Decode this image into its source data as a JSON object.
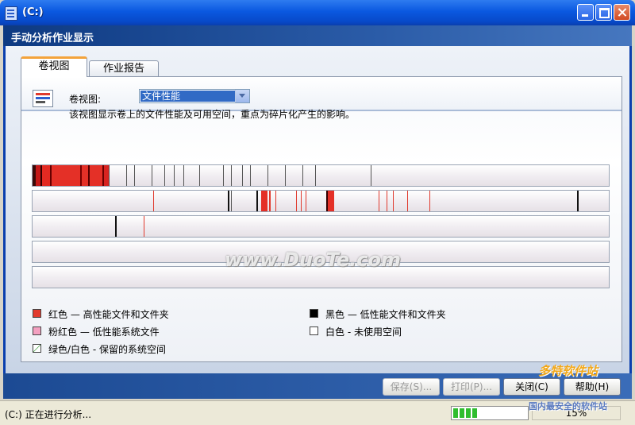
{
  "window": {
    "title": "(C:)"
  },
  "header": {
    "title": "手动分析作业显示"
  },
  "tabs": [
    {
      "label": "卷视图",
      "active": true
    },
    {
      "label": "作业报告",
      "active": false
    }
  ],
  "volume_view": {
    "label": "卷视图:",
    "selected": "文件性能",
    "description": "该视图显示卷上的文件性能及可用空间，重点为碎片化产生的影响。"
  },
  "legend": [
    {
      "text": "红色 — 高性能文件和文件夹",
      "color": "#e23b2e"
    },
    {
      "text": "粉红色 — 低性能系统文件",
      "color": "#f3a0c0"
    },
    {
      "text": "绿色/白色 - 保留的系统空间",
      "color": "green-white"
    },
    {
      "text": "黑色 — 低性能文件和文件夹",
      "color": "#000000"
    },
    {
      "text": "白色 - 未使用空间",
      "color": "#ffffff"
    }
  ],
  "buttons": {
    "save": "保存(S)...",
    "print": "打印(P)...",
    "close": "关闭(C)",
    "help": "帮助(H)"
  },
  "status": {
    "text": "(C:) 正在进行分析...",
    "progress_percent": 15,
    "progress_label": "15%"
  },
  "watermark": {
    "main": "www.DuoTe.com",
    "logo": "多特软件站",
    "sub": "国内最安全的软件站"
  }
}
